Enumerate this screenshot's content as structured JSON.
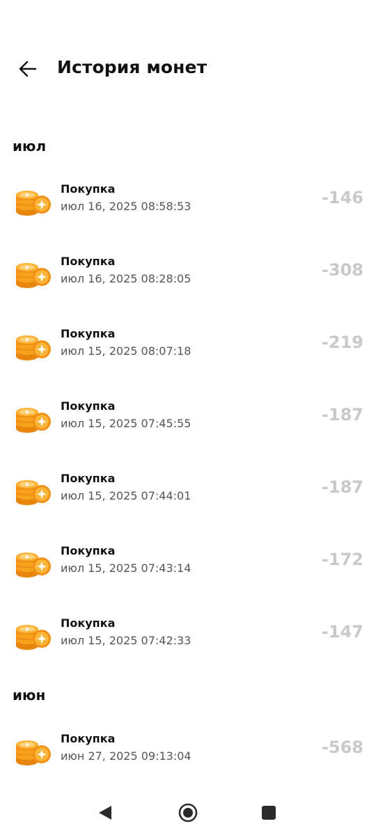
{
  "header": {
    "title": "История монет"
  },
  "sections": [
    {
      "label": "июл",
      "items": [
        {
          "title": "Покупка",
          "date": "июл 16, 2025 08:58:53",
          "amount": "-146"
        },
        {
          "title": "Покупка",
          "date": "июл 16, 2025 08:28:05",
          "amount": "-308"
        },
        {
          "title": "Покупка",
          "date": "июл 15, 2025 08:07:18",
          "amount": "-219"
        },
        {
          "title": "Покупка",
          "date": "июл 15, 2025 07:45:55",
          "amount": "-187"
        },
        {
          "title": "Покупка",
          "date": "июл 15, 2025 07:44:01",
          "amount": "-187"
        },
        {
          "title": "Покупка",
          "date": "июл 15, 2025 07:43:14",
          "amount": "-172"
        },
        {
          "title": "Покупка",
          "date": "июл 15, 2025 07:42:33",
          "amount": "-147"
        }
      ]
    },
    {
      "label": "июн",
      "items": [
        {
          "title": "Покупка",
          "date": "июн 27, 2025 09:13:04",
          "amount": "-568"
        }
      ]
    }
  ],
  "colors": {
    "amount": "#c9c9c9",
    "coin": "#f7a21b",
    "coin_dark": "#e8850c"
  },
  "icons": {
    "back": "arrow-left-icon",
    "coin": "coin-stack-icon",
    "nav_back": "triangle-back-icon",
    "nav_home": "circle-home-icon",
    "nav_recent": "square-recents-icon"
  }
}
